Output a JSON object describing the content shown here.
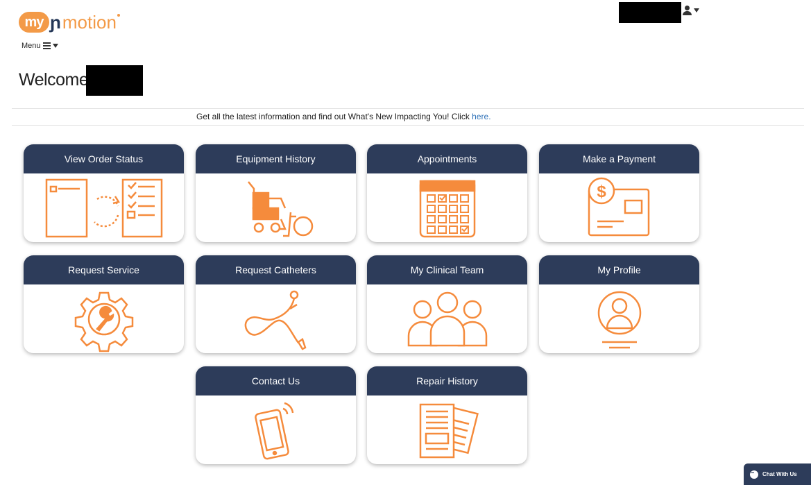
{
  "brand": {
    "logo_badge": "my",
    "logo_nu": "ɲ",
    "logo_word": "motion",
    "accent_color": "#f39a47",
    "header_color": "#2d3c5a"
  },
  "menu": {
    "label": "Menu"
  },
  "user": {
    "icon": "user-icon"
  },
  "welcome": {
    "text": "Welcome,"
  },
  "news": {
    "text": "Get all the latest information and find out What's New Impacting You! Click ",
    "link": "here."
  },
  "tiles": [
    {
      "label": "View Order Status",
      "icon": "order-status-icon"
    },
    {
      "label": "Equipment History",
      "icon": "wheelchair-icon"
    },
    {
      "label": "Appointments",
      "icon": "calendar-icon"
    },
    {
      "label": "Make a Payment",
      "icon": "payment-icon"
    },
    {
      "label": "Request Service",
      "icon": "wrench-gear-icon"
    },
    {
      "label": "Request Catheters",
      "icon": "catheter-icon"
    },
    {
      "label": "My Clinical Team",
      "icon": "team-icon"
    },
    {
      "label": "My Profile",
      "icon": "profile-icon"
    },
    {
      "label": "Contact Us",
      "icon": "phone-icon"
    },
    {
      "label": "Repair History",
      "icon": "documents-icon"
    }
  ],
  "chat": {
    "label": "Chat With Us"
  }
}
